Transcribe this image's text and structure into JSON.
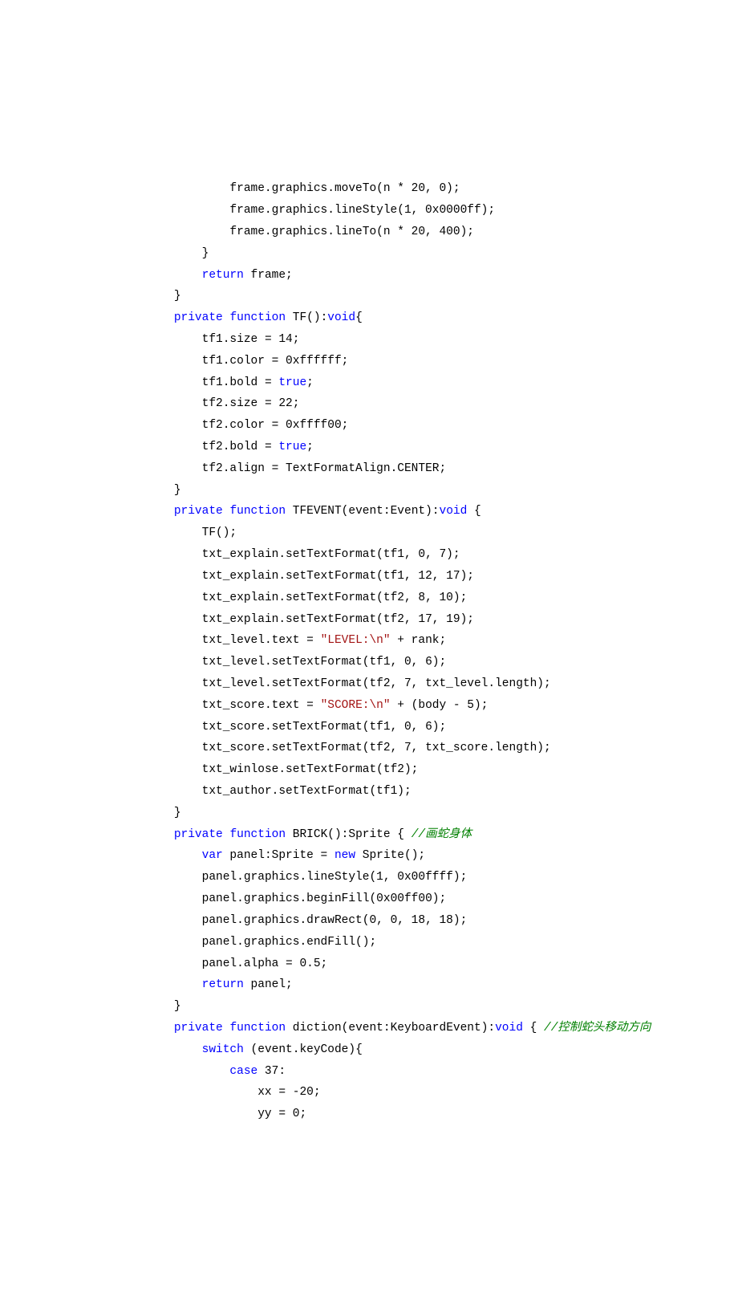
{
  "lines": [
    {
      "ind": 3,
      "parts": [
        {
          "t": "frame.graphics.moveTo(n * 20, 0);"
        }
      ]
    },
    {
      "ind": 3,
      "parts": [
        {
          "t": "frame.graphics.lineStyle(1, 0x0000ff);"
        }
      ]
    },
    {
      "ind": 3,
      "parts": [
        {
          "t": "frame.graphics.lineTo(n * 20, 400);"
        }
      ]
    },
    {
      "ind": 2,
      "parts": [
        {
          "t": "}"
        }
      ]
    },
    {
      "ind": 2,
      "parts": [
        {
          "t": "return",
          "c": "kw"
        },
        {
          "t": " frame;"
        }
      ]
    },
    {
      "ind": 1,
      "parts": [
        {
          "t": "}"
        }
      ]
    },
    {
      "ind": 1,
      "parts": [
        {
          "t": "private",
          "c": "kw"
        },
        {
          "t": " "
        },
        {
          "t": "function",
          "c": "kw"
        },
        {
          "t": " TF():"
        },
        {
          "t": "void",
          "c": "kw"
        },
        {
          "t": "{"
        }
      ]
    },
    {
      "ind": 2,
      "parts": [
        {
          "t": "tf1.size = 14;"
        }
      ]
    },
    {
      "ind": 2,
      "parts": [
        {
          "t": "tf1.color = 0xffffff;"
        }
      ]
    },
    {
      "ind": 2,
      "parts": [
        {
          "t": "tf1.bold = "
        },
        {
          "t": "true",
          "c": "kw"
        },
        {
          "t": ";"
        }
      ]
    },
    {
      "ind": 2,
      "parts": [
        {
          "t": "tf2.size = 22;"
        }
      ]
    },
    {
      "ind": 2,
      "parts": [
        {
          "t": "tf2.color = 0xffff00;"
        }
      ]
    },
    {
      "ind": 2,
      "parts": [
        {
          "t": "tf2.bold = "
        },
        {
          "t": "true",
          "c": "kw"
        },
        {
          "t": ";"
        }
      ]
    },
    {
      "ind": 2,
      "parts": [
        {
          "t": "tf2.align = TextFormatAlign.CENTER;"
        }
      ]
    },
    {
      "ind": 1,
      "parts": [
        {
          "t": "}"
        }
      ]
    },
    {
      "ind": 1,
      "parts": [
        {
          "t": "private",
          "c": "kw"
        },
        {
          "t": " "
        },
        {
          "t": "function",
          "c": "kw"
        },
        {
          "t": " TFEVENT(event:Event):"
        },
        {
          "t": "void",
          "c": "kw"
        },
        {
          "t": " {"
        }
      ]
    },
    {
      "ind": 2,
      "parts": [
        {
          "t": "TF();"
        }
      ]
    },
    {
      "ind": 2,
      "parts": [
        {
          "t": "txt_explain.setTextFormat(tf1, 0, 7);"
        }
      ]
    },
    {
      "ind": 2,
      "parts": [
        {
          "t": "txt_explain.setTextFormat(tf1, 12, 17);"
        }
      ]
    },
    {
      "ind": 2,
      "parts": [
        {
          "t": "txt_explain.setTextFormat(tf2, 8, 10);"
        }
      ]
    },
    {
      "ind": 2,
      "parts": [
        {
          "t": "txt_explain.setTextFormat(tf2, 17, 19);"
        }
      ]
    },
    {
      "ind": 2,
      "parts": [
        {
          "t": "txt_level.text = "
        },
        {
          "t": "\"LEVEL:\\n\"",
          "c": "str"
        },
        {
          "t": " + rank;"
        }
      ]
    },
    {
      "ind": 2,
      "parts": [
        {
          "t": "txt_level.setTextFormat(tf1, 0, 6);"
        }
      ]
    },
    {
      "ind": 2,
      "parts": [
        {
          "t": "txt_level.setTextFormat(tf2, 7, txt_level.length);"
        }
      ]
    },
    {
      "ind": 2,
      "parts": [
        {
          "t": "txt_score.text = "
        },
        {
          "t": "\"SCORE:\\n\"",
          "c": "str"
        },
        {
          "t": " + (body - 5);"
        }
      ]
    },
    {
      "ind": 2,
      "parts": [
        {
          "t": "txt_score.setTextFormat(tf1, 0, 6);"
        }
      ]
    },
    {
      "ind": 2,
      "parts": [
        {
          "t": "txt_score.setTextFormat(tf2, 7, txt_score.length);"
        }
      ]
    },
    {
      "ind": 2,
      "parts": [
        {
          "t": "txt_winlose.setTextFormat(tf2);"
        }
      ]
    },
    {
      "ind": 2,
      "parts": [
        {
          "t": "txt_author.setTextFormat(tf1);"
        }
      ]
    },
    {
      "ind": 1,
      "parts": [
        {
          "t": "}"
        }
      ]
    },
    {
      "ind": 1,
      "parts": [
        {
          "t": "private",
          "c": "kw"
        },
        {
          "t": " "
        },
        {
          "t": "function",
          "c": "kw"
        },
        {
          "t": " BRICK():Sprite { "
        },
        {
          "t": "//画蛇身体",
          "c": "cm"
        }
      ]
    },
    {
      "ind": 2,
      "parts": [
        {
          "t": "var",
          "c": "kw"
        },
        {
          "t": " panel:Sprite = "
        },
        {
          "t": "new",
          "c": "kw"
        },
        {
          "t": " Sprite();"
        }
      ]
    },
    {
      "ind": 2,
      "parts": [
        {
          "t": "panel.graphics.lineStyle(1, 0x00ffff);"
        }
      ]
    },
    {
      "ind": 2,
      "parts": [
        {
          "t": "panel.graphics.beginFill(0x00ff00);"
        }
      ]
    },
    {
      "ind": 2,
      "parts": [
        {
          "t": "panel.graphics.drawRect(0, 0, 18, 18);"
        }
      ]
    },
    {
      "ind": 2,
      "parts": [
        {
          "t": "panel.graphics.endFill();"
        }
      ]
    },
    {
      "ind": 2,
      "parts": [
        {
          "t": "panel.alpha = 0.5;"
        }
      ]
    },
    {
      "ind": 2,
      "parts": [
        {
          "t": "return",
          "c": "kw"
        },
        {
          "t": " panel;"
        }
      ]
    },
    {
      "ind": 1,
      "parts": [
        {
          "t": "}"
        }
      ]
    },
    {
      "ind": 1,
      "parts": [
        {
          "t": "private",
          "c": "kw"
        },
        {
          "t": " "
        },
        {
          "t": "function",
          "c": "kw"
        },
        {
          "t": " diction(event:KeyboardEvent):"
        },
        {
          "t": "void",
          "c": "kw"
        },
        {
          "t": " { "
        },
        {
          "t": "//控制蛇头移动方向",
          "c": "cm"
        }
      ]
    },
    {
      "ind": 2,
      "parts": [
        {
          "t": "switch",
          "c": "kw"
        },
        {
          "t": " (event.keyCode){"
        }
      ]
    },
    {
      "ind": 3,
      "parts": [
        {
          "t": "case",
          "c": "kw"
        },
        {
          "t": " 37:"
        }
      ]
    },
    {
      "ind": 4,
      "parts": [
        {
          "t": "xx = -20;"
        }
      ]
    },
    {
      "ind": 4,
      "parts": [
        {
          "t": "yy = 0;"
        }
      ]
    }
  ],
  "indentUnit": "    "
}
